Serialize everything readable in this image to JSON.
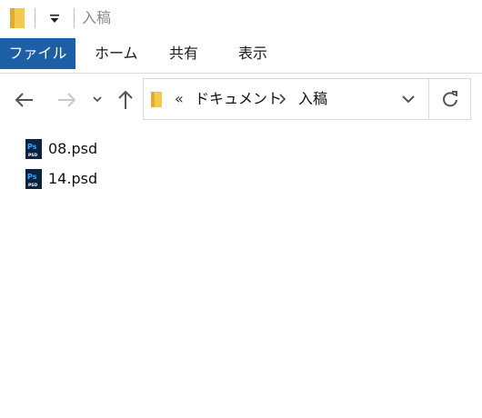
{
  "window": {
    "title": "入稿"
  },
  "quick_access": {
    "folder_icon": "folder-icon",
    "dropdown_icon": "customize-dropdown-icon"
  },
  "ribbon": {
    "tabs": [
      {
        "label": "ファイル",
        "active": true
      },
      {
        "label": "ホーム"
      },
      {
        "label": "共有"
      },
      {
        "label": "表示"
      }
    ]
  },
  "navigation": {
    "back_icon": "arrow-left-icon",
    "forward_icon": "arrow-right-icon",
    "recent_icon": "chevron-down-icon",
    "up_icon": "arrow-up-icon"
  },
  "address_bar": {
    "overflow_marker": "«",
    "breadcrumbs": [
      "ドキュメント",
      "入稿"
    ],
    "refresh_icon": "refresh-icon"
  },
  "files": [
    {
      "name": "08.psd",
      "icon": "photoshop-file-icon"
    },
    {
      "name": "14.psd",
      "icon": "photoshop-file-icon"
    }
  ],
  "colors": {
    "file_tab_bg": "#1c5fa6",
    "ps_icon_bg": "#0b2340",
    "ps_icon_fg": "#31a8ff",
    "folder": "#f3c94f"
  }
}
